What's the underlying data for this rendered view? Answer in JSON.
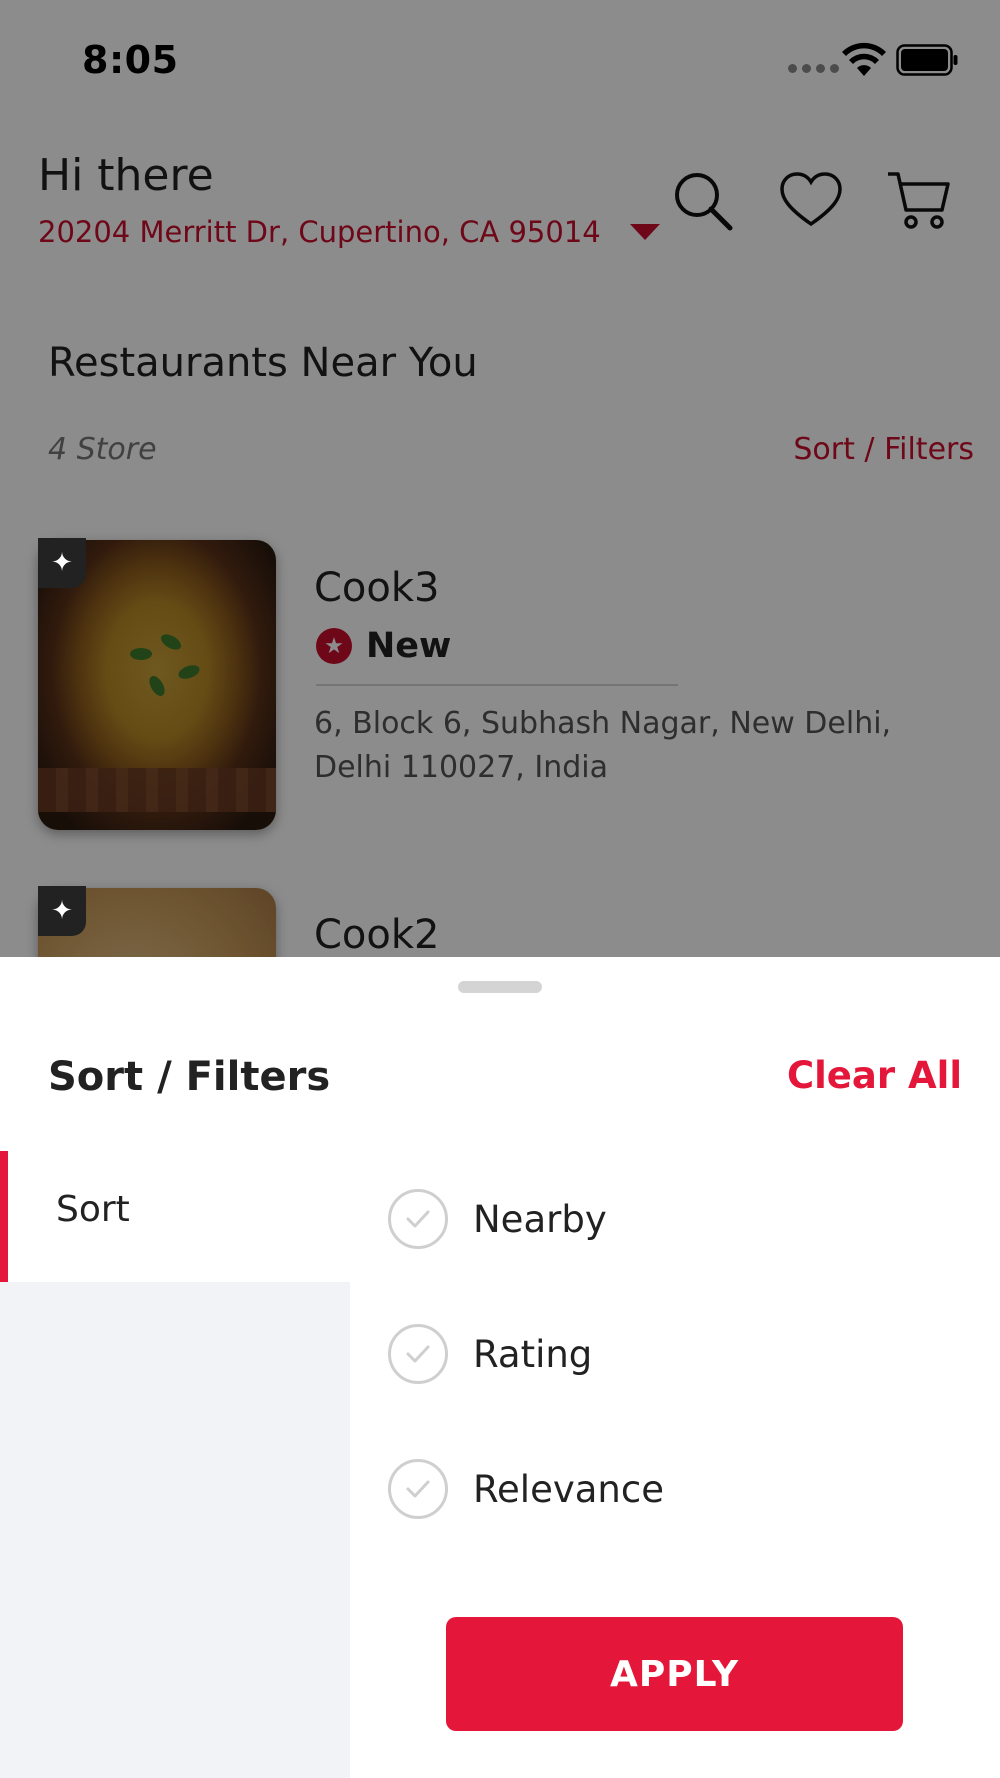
{
  "status_bar": {
    "time": "8:05"
  },
  "header": {
    "greeting": "Hi there",
    "address": "20204 Merritt Dr, Cupertino, CA  95014,...",
    "icons": [
      "search-icon",
      "heart-icon",
      "cart-icon"
    ]
  },
  "section": {
    "title": "Restaurants Near You",
    "store_count": "4 Store",
    "sort_filters_link": "Sort / Filters"
  },
  "restaurants": [
    {
      "name": "Cook3",
      "tag": "New",
      "address": "6, Block 6, Subhash Nagar, New Delhi, Delhi 110027, India"
    },
    {
      "name": "Cook2"
    }
  ],
  "sheet": {
    "title": "Sort / Filters",
    "clear_all": "Clear All",
    "categories": [
      {
        "label": "Sort",
        "active": true
      }
    ],
    "options": [
      {
        "label": "Nearby",
        "selected": false
      },
      {
        "label": "Rating",
        "selected": false
      },
      {
        "label": "Relevance",
        "selected": false
      }
    ],
    "apply_label": "APPLY"
  },
  "colors": {
    "accent": "#e4173a",
    "link": "#c8102e",
    "side_panel_bg": "#f2f3f7"
  }
}
